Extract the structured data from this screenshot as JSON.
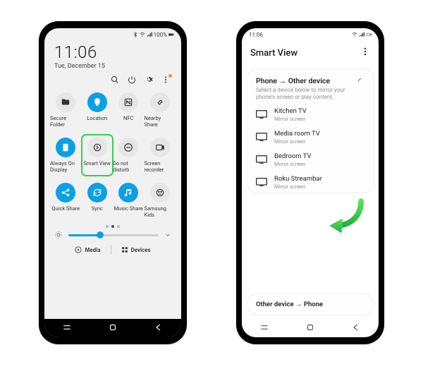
{
  "p1": {
    "status": {
      "time_left": "",
      "battery_text": "100%"
    },
    "clock": {
      "time": "11:06",
      "date": "Tue, December 15"
    },
    "header_icons": [
      "search",
      "power",
      "settings",
      "more"
    ],
    "tiles": [
      {
        "label": "Secure Folder",
        "icon": "folder",
        "on": false
      },
      {
        "label": "Location",
        "icon": "location",
        "on": true
      },
      {
        "label": "NFC",
        "icon": "nfc",
        "on": false
      },
      {
        "label": "Nearby Share",
        "icon": "share",
        "on": false
      },
      {
        "label": "Always On Display",
        "icon": "aod",
        "on": true
      },
      {
        "label": "Smart View",
        "icon": "smartview",
        "on": false,
        "highlight": true
      },
      {
        "label": "Do not disturb",
        "icon": "dnd",
        "on": false
      },
      {
        "label": "Screen recorder",
        "icon": "recorder",
        "on": false
      },
      {
        "label": "Quick Share",
        "icon": "quickshare",
        "on": true
      },
      {
        "label": "Sync",
        "icon": "sync",
        "on": true
      },
      {
        "label": "Music Share",
        "icon": "music",
        "on": true
      },
      {
        "label": "Samsung Kids",
        "icon": "kids",
        "on": false
      }
    ],
    "brightness_pct": 35,
    "bottom": {
      "media": "Media",
      "devices": "Devices"
    }
  },
  "p2": {
    "status": {
      "time_left": "11:06"
    },
    "header": "Smart View",
    "section_title": "Phone → Other device",
    "section_sub": "Select a device below to mirror your phone's screen or play content.",
    "devices": [
      {
        "name": "Kitchen TV",
        "sub": "Mirror screen"
      },
      {
        "name": "Media room TV",
        "sub": "Mirror screen"
      },
      {
        "name": "Bedroom TV",
        "sub": "Mirror screen"
      },
      {
        "name": "Roku Streambar",
        "sub": "Mirror screen"
      }
    ],
    "other_section": "Other device → Phone"
  }
}
